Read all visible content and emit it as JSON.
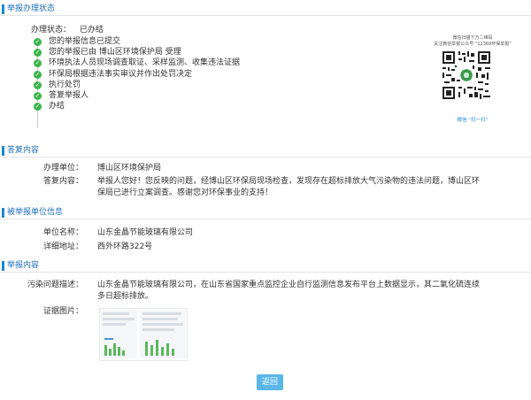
{
  "sections": {
    "status": "举报办理状态",
    "reply": "答复内容",
    "reported_unit": "被举报单位信息",
    "content": "举报内容"
  },
  "status": {
    "label": "办理状态：",
    "value": "已办结",
    "steps": [
      "您的举报信息已提交",
      "您的举报已由 博山区环境保护局 受理",
      "环境执法人员现场调查取证、采样监测、收集违法证据",
      "环保局根据违法事实审议并作出处罚决定",
      "执行处罚",
      "答复举报人",
      "办结"
    ]
  },
  "qr": {
    "line1": "微信扫描下方二维码",
    "line2": "关注微信举报公众号 “12369环保举报”",
    "caption": "微信 “扫一扫”"
  },
  "reply": {
    "unit_label": "办理单位：",
    "unit_value": "博山区环境保护局",
    "content_label": "答复内容：",
    "content_value": "举报人您好！您反映的问题，经博山区环保局现场检查，发现存在超标排放大气污染物的违法问题，博山区环保局已进行立案调查。感谢您对环保事业的支持！"
  },
  "unit": {
    "name_label": "单位名称：",
    "name_value": "山东金晶节能玻璃有限公司",
    "address_label": "详细地址：",
    "address_value": "西外环路322号"
  },
  "content": {
    "issue_label": "污染问题描述：",
    "issue_value": "山东金晶节能玻璃有限公司，在山东省国家重点监控企业自行监测信息发布平台上数据显示，其二氧化硫连续多日超标排放。",
    "evidence_label": "证据图片："
  },
  "back_button": "返回",
  "colors": {
    "accent": "#1e88d0",
    "check": "#3bb54a",
    "button": "#5ab7e8"
  }
}
